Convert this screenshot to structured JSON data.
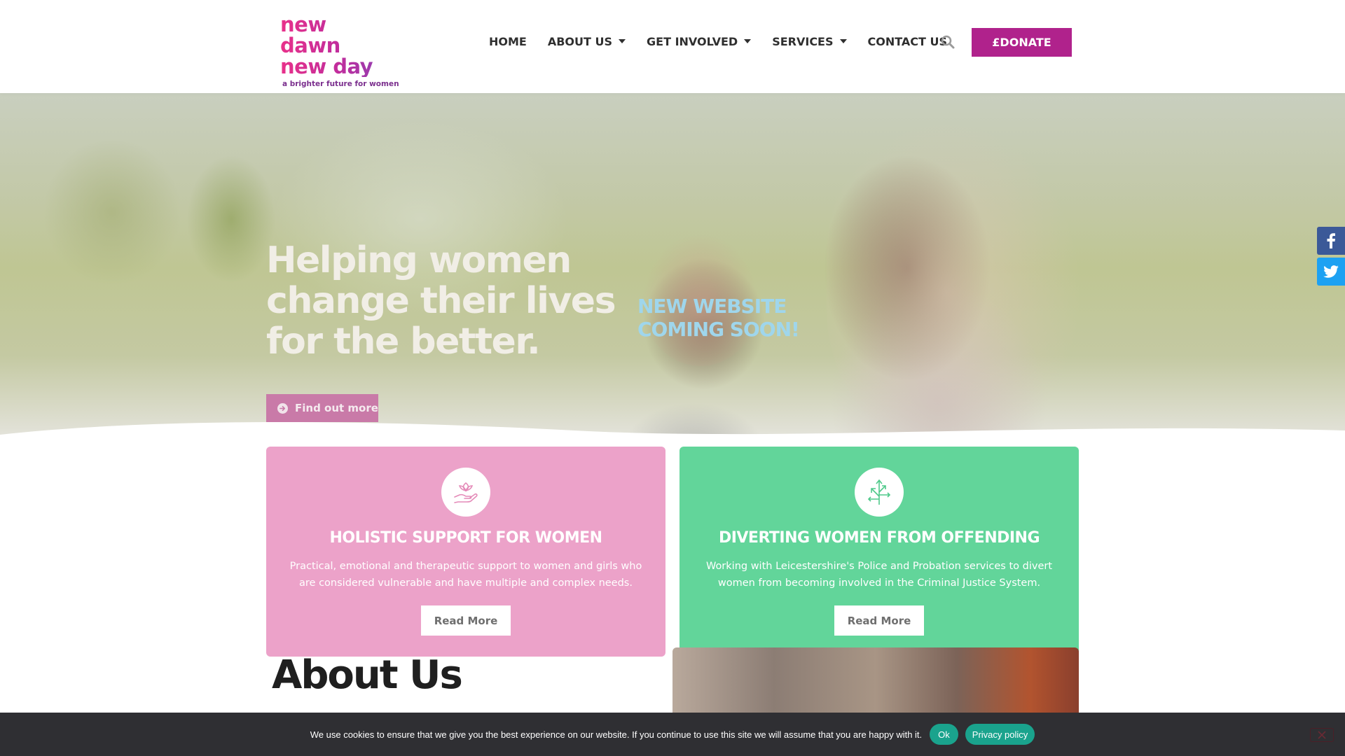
{
  "header": {
    "logo": {
      "line1": "new dawn",
      "line2": "new day",
      "tagline": "a brighter future for women"
    },
    "nav": [
      {
        "label": "HOME",
        "dropdown": false
      },
      {
        "label": "ABOUT US",
        "dropdown": true
      },
      {
        "label": "GET INVOLVED",
        "dropdown": true
      },
      {
        "label": "SERVICES",
        "dropdown": true
      },
      {
        "label": "CONTACT US",
        "dropdown": false
      }
    ],
    "search_icon": "search-icon",
    "donate_label": "£DONATE"
  },
  "hero": {
    "title": "Helping women change their lives for the better.",
    "coming_soon_line1": "NEW WEBSITE",
    "coming_soon_line2": "COMING SOON!",
    "button_label": "Find out more",
    "button_icon": "arrow-circle-right-icon"
  },
  "social": [
    {
      "name": "facebook",
      "icon": "facebook-icon",
      "color": "#3b5998"
    },
    {
      "name": "twitter",
      "icon": "twitter-icon",
      "color": "#1da1f2"
    }
  ],
  "cards": [
    {
      "title": "HOLISTIC SUPPORT  FOR WOMEN",
      "text": "Practical, emotional and therapeutic support to women and girls who are considered vulnerable and have multiple and complex needs.",
      "button_label": "Read More",
      "icon": "hand-flower-icon",
      "color": "#eca2c9"
    },
    {
      "title": "DIVERTING WOMEN  FROM OFFENDING",
      "text": "Working with Leicestershire's Police and Probation services to divert women from becoming involved in the Criminal Justice System.",
      "button_label": "Read More",
      "icon": "directions-arrows-icon",
      "color": "#62d59a"
    }
  ],
  "about": {
    "title": "About Us"
  },
  "cookie_bar": {
    "text": "We use cookies to ensure that we give you the best experience on our website. If you continue to use this site we will assume that you are happy with it.",
    "ok_label": "Ok",
    "privacy_label": "Privacy policy"
  },
  "colors": {
    "brand_magenta": "#b0228c",
    "pink_card": "#eca2c9",
    "green_card": "#62d59a",
    "cookie_button": "#1aa38d"
  }
}
